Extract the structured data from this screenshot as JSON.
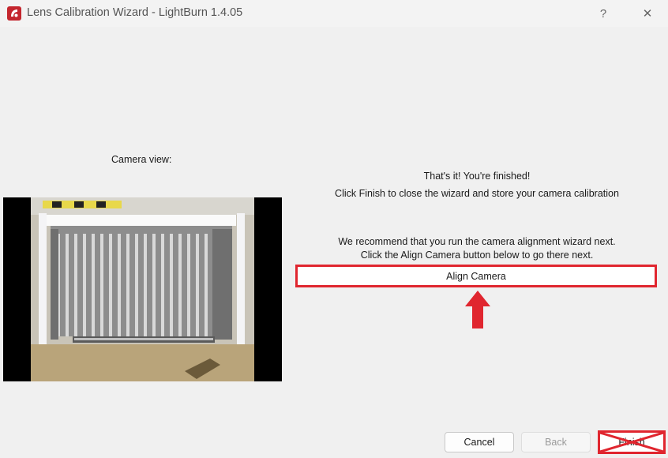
{
  "window": {
    "title": "Lens Calibration Wizard - LightBurn 1.4.05",
    "help_glyph": "?",
    "close_glyph": "✕",
    "icon": "lightburn-logo-icon"
  },
  "camera": {
    "label": "Camera view:"
  },
  "messages": {
    "finished": "That's it!  You're finished!",
    "instruction": "Click Finish to close the wizard and store your camera calibration",
    "recommend": "We recommend that you run the camera alignment wizard next.",
    "align_hint": "Click the Align Camera button below to go there next."
  },
  "buttons": {
    "align_camera": "Align Camera",
    "cancel": "Cancel",
    "back": "Back",
    "finish": "Finish"
  },
  "annotation": {
    "highlight_color": "#e0262f",
    "arrow_icon": "up-arrow-icon",
    "cross_icon": "cross-out-icon"
  }
}
